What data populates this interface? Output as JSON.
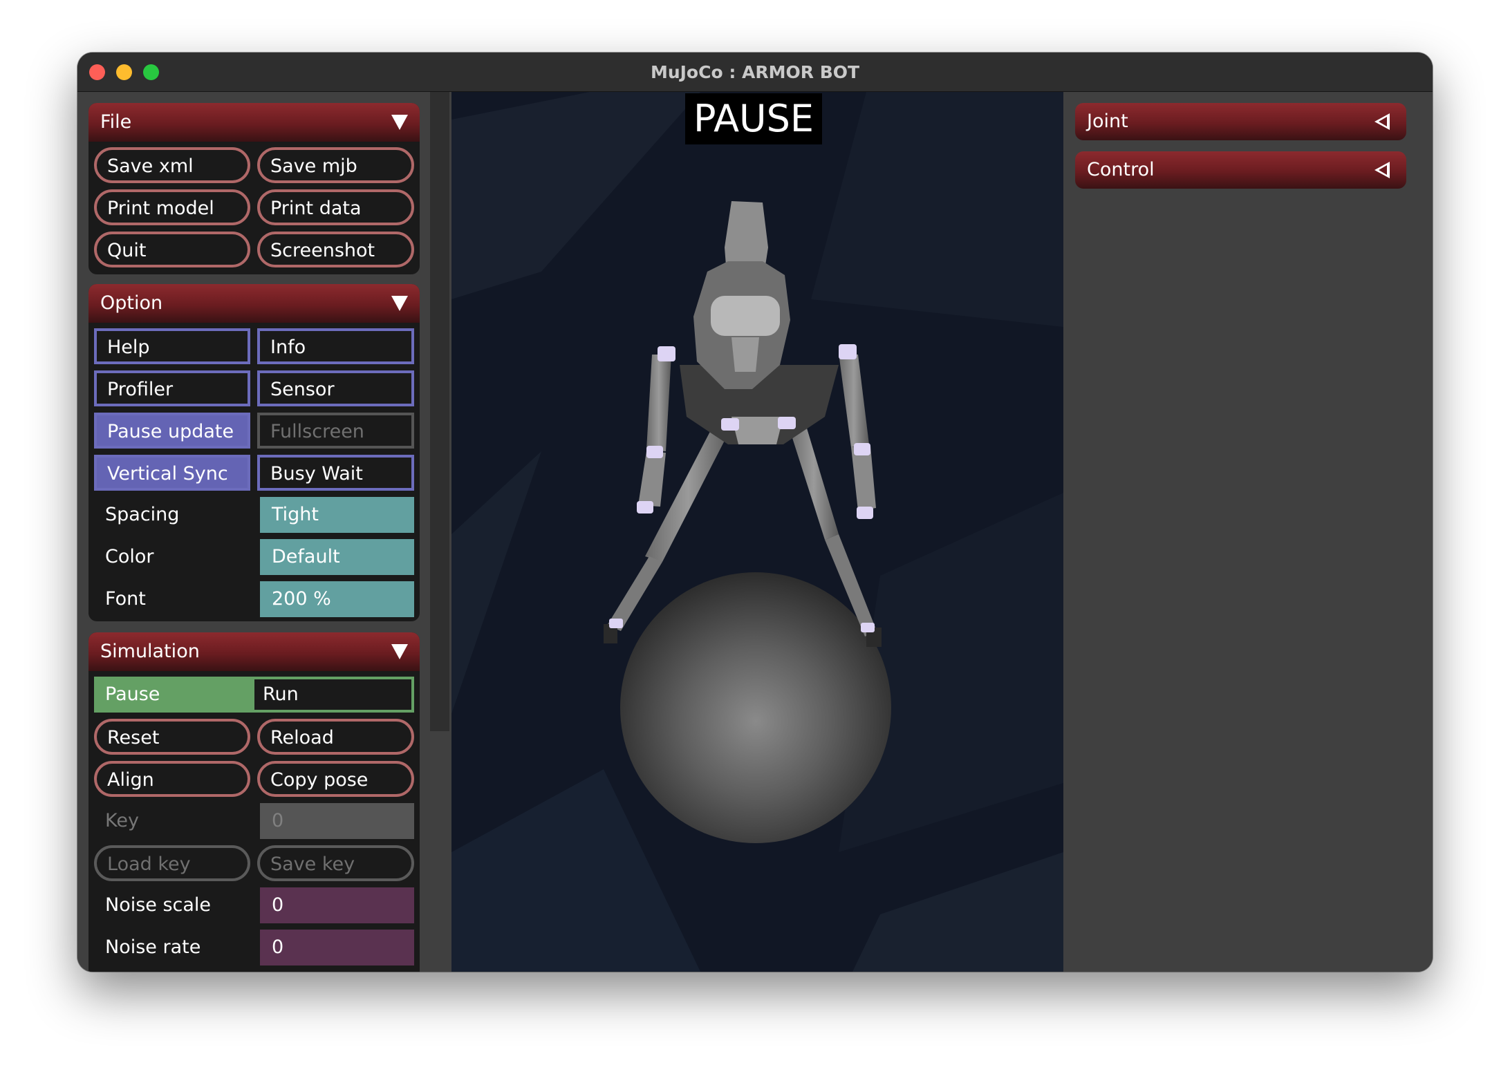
{
  "window": {
    "title": "MuJoCo : ARMOR BOT"
  },
  "file": {
    "title": "File",
    "buttons": [
      "Save xml",
      "Save mjb",
      "Print model",
      "Print data",
      "Quit",
      "Screenshot"
    ]
  },
  "option": {
    "title": "Option",
    "toggles": [
      {
        "label": "Help",
        "on": false,
        "enabled": true
      },
      {
        "label": "Info",
        "on": false,
        "enabled": true
      },
      {
        "label": "Profiler",
        "on": false,
        "enabled": true
      },
      {
        "label": "Sensor",
        "on": false,
        "enabled": true
      },
      {
        "label": "Pause update",
        "on": true,
        "enabled": true
      },
      {
        "label": "Fullscreen",
        "on": false,
        "enabled": false
      },
      {
        "label": "Vertical Sync",
        "on": true,
        "enabled": true
      },
      {
        "label": "Busy Wait",
        "on": false,
        "enabled": true
      }
    ],
    "spacing_label": "Spacing",
    "spacing_value": "Tight",
    "color_label": "Color",
    "color_value": "Default",
    "font_label": "Font",
    "font_value": "200 %"
  },
  "simulation": {
    "title": "Simulation",
    "run_mode": {
      "options": [
        "Pause",
        "Run"
      ],
      "selected": "Pause"
    },
    "buttons": [
      "Reset",
      "Reload",
      "Align",
      "Copy pose"
    ],
    "key_label": "Key",
    "key_value": "0",
    "key_buttons": [
      "Load key",
      "Save key"
    ],
    "noise_scale_label": "Noise scale",
    "noise_scale_value": "0",
    "noise_rate_label": "Noise rate",
    "noise_rate_value": "0"
  },
  "viewport": {
    "status": "PAUSE"
  },
  "right": {
    "sections": [
      "Joint",
      "Control"
    ]
  },
  "colors": {
    "section_header": "#8c2a2e",
    "toggle_on": "#6464b4",
    "select": "#62a0a0",
    "edit": "#5a3250",
    "radio_on": "#64a064"
  }
}
